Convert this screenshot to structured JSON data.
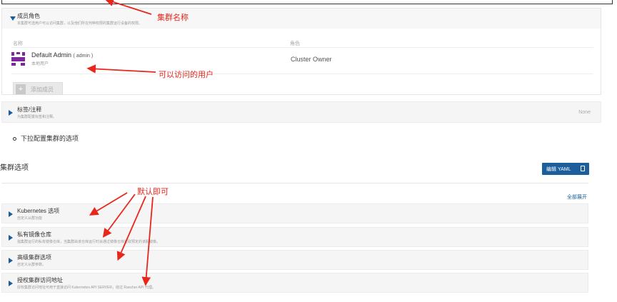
{
  "members_section": {
    "title": "成员角色",
    "subtitle": "本集群可选用户可以访问集群，以及他们所在何种权限的集群运行设备的权限。",
    "col_name": "名称",
    "col_role": "角色",
    "member": {
      "name": "Default Admin",
      "username_suffix": "( admin )",
      "type": "本地用户",
      "role": "Cluster Owner"
    },
    "add_button": "添加成员"
  },
  "labels_section": {
    "title": "标签/注释",
    "subtitle": "为集群配置标签和注释。",
    "value": "None"
  },
  "bullet_text": "下拉配置集群的选项",
  "cluster_options": {
    "title": "集群选项",
    "edit_yaml": "编辑 YAML",
    "expand_all": "全部展开",
    "sections": [
      {
        "title": "Kubernetes 选项",
        "subtitle": "自定义从群功能"
      },
      {
        "title": "私有镜像仓库",
        "subtitle": "指集群运行的私有镜像仓库，当集群由该仓库运行时会通过镜像仓库拉取预定的该服镜像。"
      },
      {
        "title": "高级集群选项",
        "subtitle": "自定义从群参数。"
      },
      {
        "title": "授权集群访问地址",
        "subtitle": "授权集群访问地址可用于直接访问 Kubernetes API SERVER，绕过 Rancher API 代理。"
      }
    ]
  },
  "annotations": {
    "cluster_name": "集群名称",
    "accessible_users": "可以访问的用户",
    "default_ok": "默认即可"
  },
  "colors": {
    "accent": "#1b5e9b",
    "annotation": "#e8261b",
    "avatar": "#7b2a9e"
  }
}
